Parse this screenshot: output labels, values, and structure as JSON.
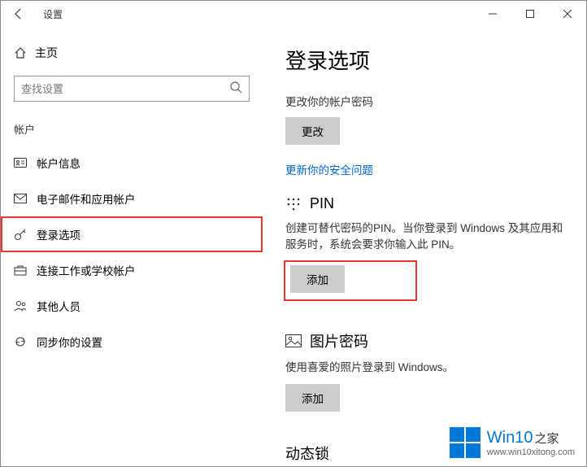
{
  "titlebar": {
    "title": "设置"
  },
  "sidebar": {
    "home": "主页",
    "search_placeholder": "查找设置",
    "section": "帐户",
    "items": [
      {
        "label": "帐户信息"
      },
      {
        "label": "电子邮件和应用帐户"
      },
      {
        "label": "登录选项"
      },
      {
        "label": "连接工作或学校帐户"
      },
      {
        "label": "其他人员"
      },
      {
        "label": "同步你的设置"
      }
    ]
  },
  "main": {
    "heading": "登录选项",
    "password_desc": "更改你的帐户密码",
    "change_btn": "更改",
    "security_link": "更新你的安全问题",
    "pin_title": "PIN",
    "pin_desc": "创建可替代密码的PIN。当你登录到 Windows 及其应用和服务时，系统会要求你输入此 PIN。",
    "add_btn": "添加",
    "pic_title": "图片密码",
    "pic_desc": "使用喜爱的照片登录到 Windows。",
    "pic_add_btn": "添加",
    "dynamic_title": "动态锁"
  },
  "watermark": {
    "brand": "Win10",
    "suffix": "之家",
    "url": "www.win10xitong.com"
  }
}
